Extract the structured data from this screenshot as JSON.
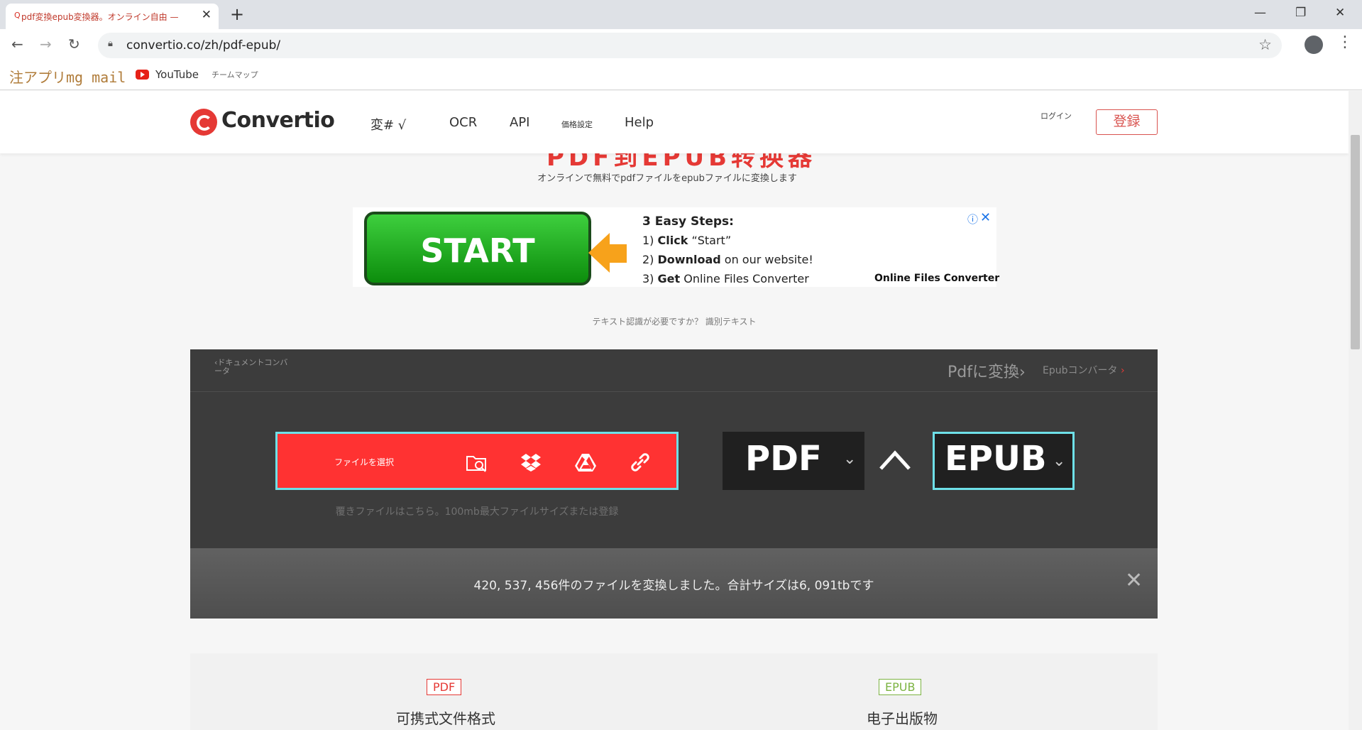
{
  "browser": {
    "tab_favicon": "Q",
    "tab_title": "pdf変換epub変換器。オンライン自由 —",
    "tab_close": "✕",
    "new_tab": "+",
    "url": "convertio.co/zh/pdf-epub/",
    "back": "←",
    "forward": "→",
    "reload": "↻",
    "star": "☆",
    "menu": "⋮",
    "window": {
      "minimize": "—",
      "restore": "❐",
      "close": "✕"
    }
  },
  "bookmarks": [
    {
      "label": "注アプリmg mail"
    },
    {
      "label": "YouTube",
      "icon": "youtube-icon"
    },
    {
      "label": "チームマップ"
    }
  ],
  "header": {
    "logo": "Convertio",
    "nav": [
      {
        "label": "変# √"
      },
      {
        "label": "OCR"
      },
      {
        "label": "API"
      },
      {
        "label": "価格設定"
      },
      {
        "label": "Help"
      }
    ],
    "login": "ログイン",
    "signup": "登録"
  },
  "hero": {
    "title_cut": "PDF到EPUB转换器",
    "subtitle": "オンラインで無料でpdfファイルをepubファイルに変換します"
  },
  "ad": {
    "button": "START",
    "heading": "3 Easy Steps:",
    "steps": [
      {
        "num": "1)",
        "bold": "Click",
        "rest": " “Start”"
      },
      {
        "num": "2)",
        "bold": "Download",
        "rest": " on our website!"
      },
      {
        "num": "3)",
        "bold": "Get",
        "rest": " Online Files Converter"
      }
    ],
    "brand": "Online Files Converter",
    "info": "ⓘ",
    "close": "✕"
  },
  "ocr_hint": "テキスト認識が必要ですか？ 識別テキスト",
  "converter": {
    "breadcrumb_left": "‹ドキュメントコンバータ",
    "breadcrumb_right1": "Pdfに変換›",
    "breadcrumb_right2": "Epubコンバータ",
    "breadcrumb_right2_arrow": "›",
    "choose_label": "ファイルを選択",
    "drop_hint": "覆きファイルはこちら。100mb最大ファイルサイズまたは登録",
    "from_format": "PDF",
    "to_format": "EPUB",
    "chevron": "⌄",
    "icons": [
      "folder-search-icon",
      "dropbox-icon",
      "google-drive-icon",
      "link-icon"
    ]
  },
  "counter": {
    "text": "420, 537, 456件のファイルを変換しました。合計サイズは6, 091tbです",
    "close": "✕"
  },
  "formats": [
    {
      "badge": "PDF",
      "name": "可携式文件格式"
    },
    {
      "badge": "EPUB",
      "name": "电子出版物"
    }
  ],
  "colors": {
    "brand_red": "#e53935",
    "choose_red": "#ff3232",
    "highlight_cyan": "#6ee0e8",
    "panel_dark": "#3c3c3c",
    "epub_green": "#7cb342"
  }
}
